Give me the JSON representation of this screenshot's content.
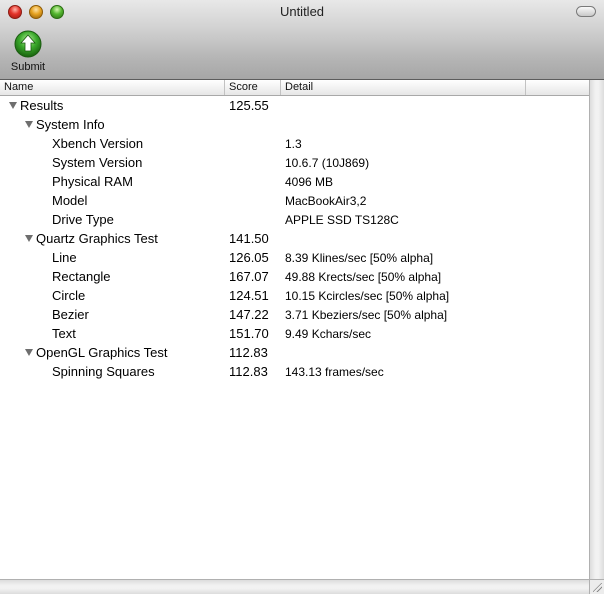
{
  "window": {
    "title": "Untitled"
  },
  "toolbar": {
    "submit_label": "Submit",
    "submit_icon": "green-up-arrow-icon"
  },
  "columns": {
    "name": "Name",
    "score": "Score",
    "detail": "Detail",
    "extra": ""
  },
  "rows": [
    {
      "level": 0,
      "expanded": true,
      "name": "Results",
      "score": "125.55",
      "detail": ""
    },
    {
      "level": 1,
      "expanded": true,
      "name": "System Info",
      "score": "",
      "detail": ""
    },
    {
      "level": 2,
      "name": "Xbench Version",
      "score": "",
      "detail": "1.3"
    },
    {
      "level": 2,
      "name": "System Version",
      "score": "",
      "detail": "10.6.7 (10J869)"
    },
    {
      "level": 2,
      "name": "Physical RAM",
      "score": "",
      "detail": "4096 MB"
    },
    {
      "level": 2,
      "name": "Model",
      "score": "",
      "detail": "MacBookAir3,2"
    },
    {
      "level": 2,
      "name": "Drive Type",
      "score": "",
      "detail": "APPLE SSD TS128C"
    },
    {
      "level": 1,
      "expanded": true,
      "name": "Quartz Graphics Test",
      "score": "141.50",
      "detail": ""
    },
    {
      "level": 2,
      "name": "Line",
      "score": "126.05",
      "detail": "8.39 Klines/sec [50% alpha]"
    },
    {
      "level": 2,
      "name": "Rectangle",
      "score": "167.07",
      "detail": "49.88 Krects/sec [50% alpha]"
    },
    {
      "level": 2,
      "name": "Circle",
      "score": "124.51",
      "detail": "10.15 Kcircles/sec [50% alpha]"
    },
    {
      "level": 2,
      "name": "Bezier",
      "score": "147.22",
      "detail": "3.71 Kbeziers/sec [50% alpha]"
    },
    {
      "level": 2,
      "name": "Text",
      "score": "151.70",
      "detail": "9.49 Kchars/sec"
    },
    {
      "level": 1,
      "expanded": true,
      "name": "OpenGL Graphics Test",
      "score": "112.83",
      "detail": ""
    },
    {
      "level": 2,
      "name": "Spinning Squares",
      "score": "112.83",
      "detail": "143.13 frames/sec"
    }
  ],
  "colors": {
    "submit_green": "#3aa82b",
    "disclosure": "#6e6e6e"
  }
}
